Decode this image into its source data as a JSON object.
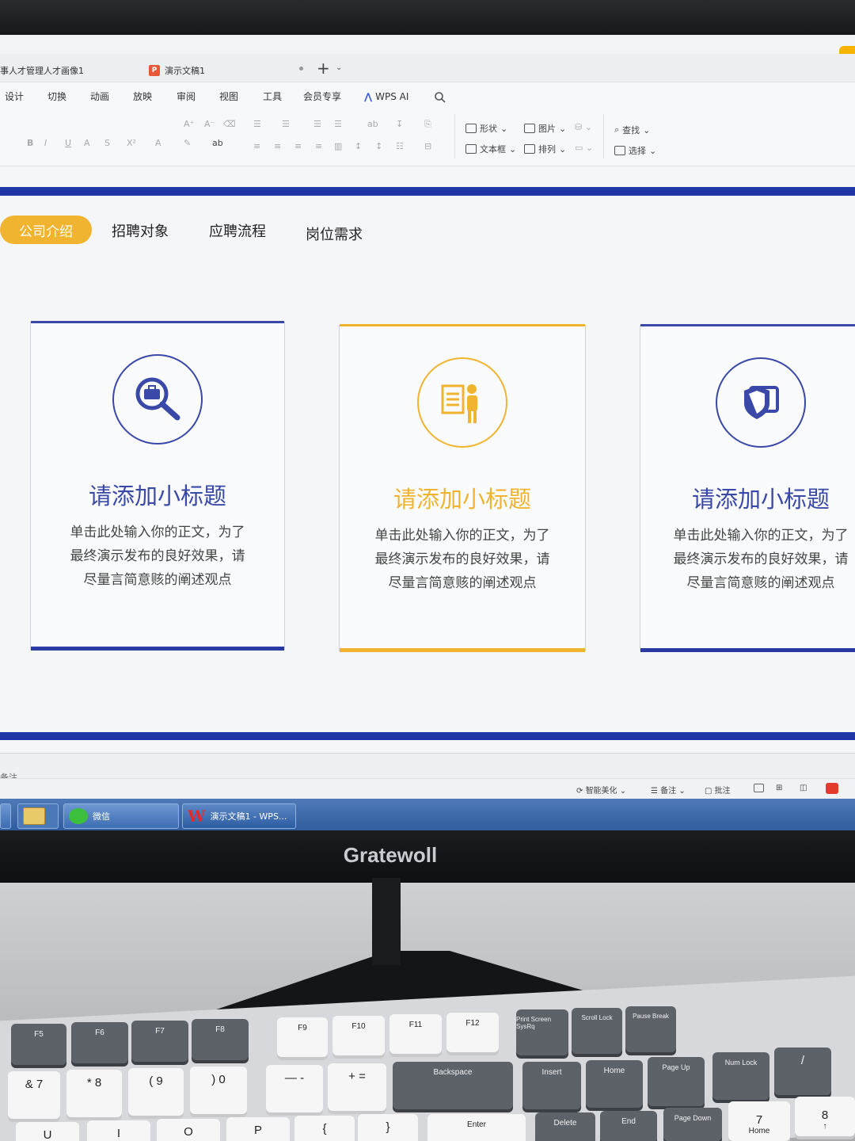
{
  "tabs": [
    {
      "label": "事人才管理人才画像1"
    },
    {
      "label": "演示文稿1",
      "icon": "P"
    }
  ],
  "menu": [
    "设计",
    "切换",
    "动画",
    "放映",
    "审阅",
    "视图",
    "工具",
    "会员专享"
  ],
  "wps_ai": "WPS AI",
  "ribbon": {
    "shape": "形状",
    "picture": "图片",
    "textbox": "文本框",
    "arrange": "排列",
    "find": "查找",
    "select": "选择"
  },
  "slide": {
    "nav": [
      "公司介绍",
      "招聘对象",
      "应聘流程",
      "岗位需求"
    ],
    "cards": [
      {
        "title": "请添加小标题",
        "body": [
          "单击此处输入你的正文，为了",
          "最终演示发布的良好效果，请",
          "尽量言简意赅的阐述观点"
        ],
        "color": "#3a48a8"
      },
      {
        "title": "请添加小标题",
        "body": [
          "单击此处输入你的正文，为了",
          "最终演示发布的良好效果，请",
          "尽量言简意赅的阐述观点"
        ],
        "color": "#f1b431"
      },
      {
        "title": "请添加小标题",
        "body": [
          "单击此处输入你的正文，为了",
          "最终演示发布的良好效果，请",
          "尽量言简意赅的阐述观点"
        ],
        "color": "#3a48a8"
      }
    ]
  },
  "notes_label": "备注",
  "status": {
    "beautify": "智能美化",
    "notes": "备注",
    "comments": "批注"
  },
  "taskbar": {
    "wechat": "微信",
    "wps": "演示文稿1 - WPS..."
  },
  "brand": "Gratewoll",
  "keys": {
    "fn": [
      "F5",
      "F6",
      "F7",
      "F8",
      "F9",
      "F10",
      "F11",
      "F12"
    ],
    "nav": [
      "Print Screen SysRq",
      "Scroll Lock",
      "Pause Break",
      "Insert",
      "Home",
      "Page Up",
      "Delete",
      "End",
      "Page Down"
    ],
    "backspace": "Backspace",
    "enter": "Enter",
    "numlock": "Num Lock",
    "num7": "7",
    "num7_sub": "Home",
    "num8": "8"
  }
}
